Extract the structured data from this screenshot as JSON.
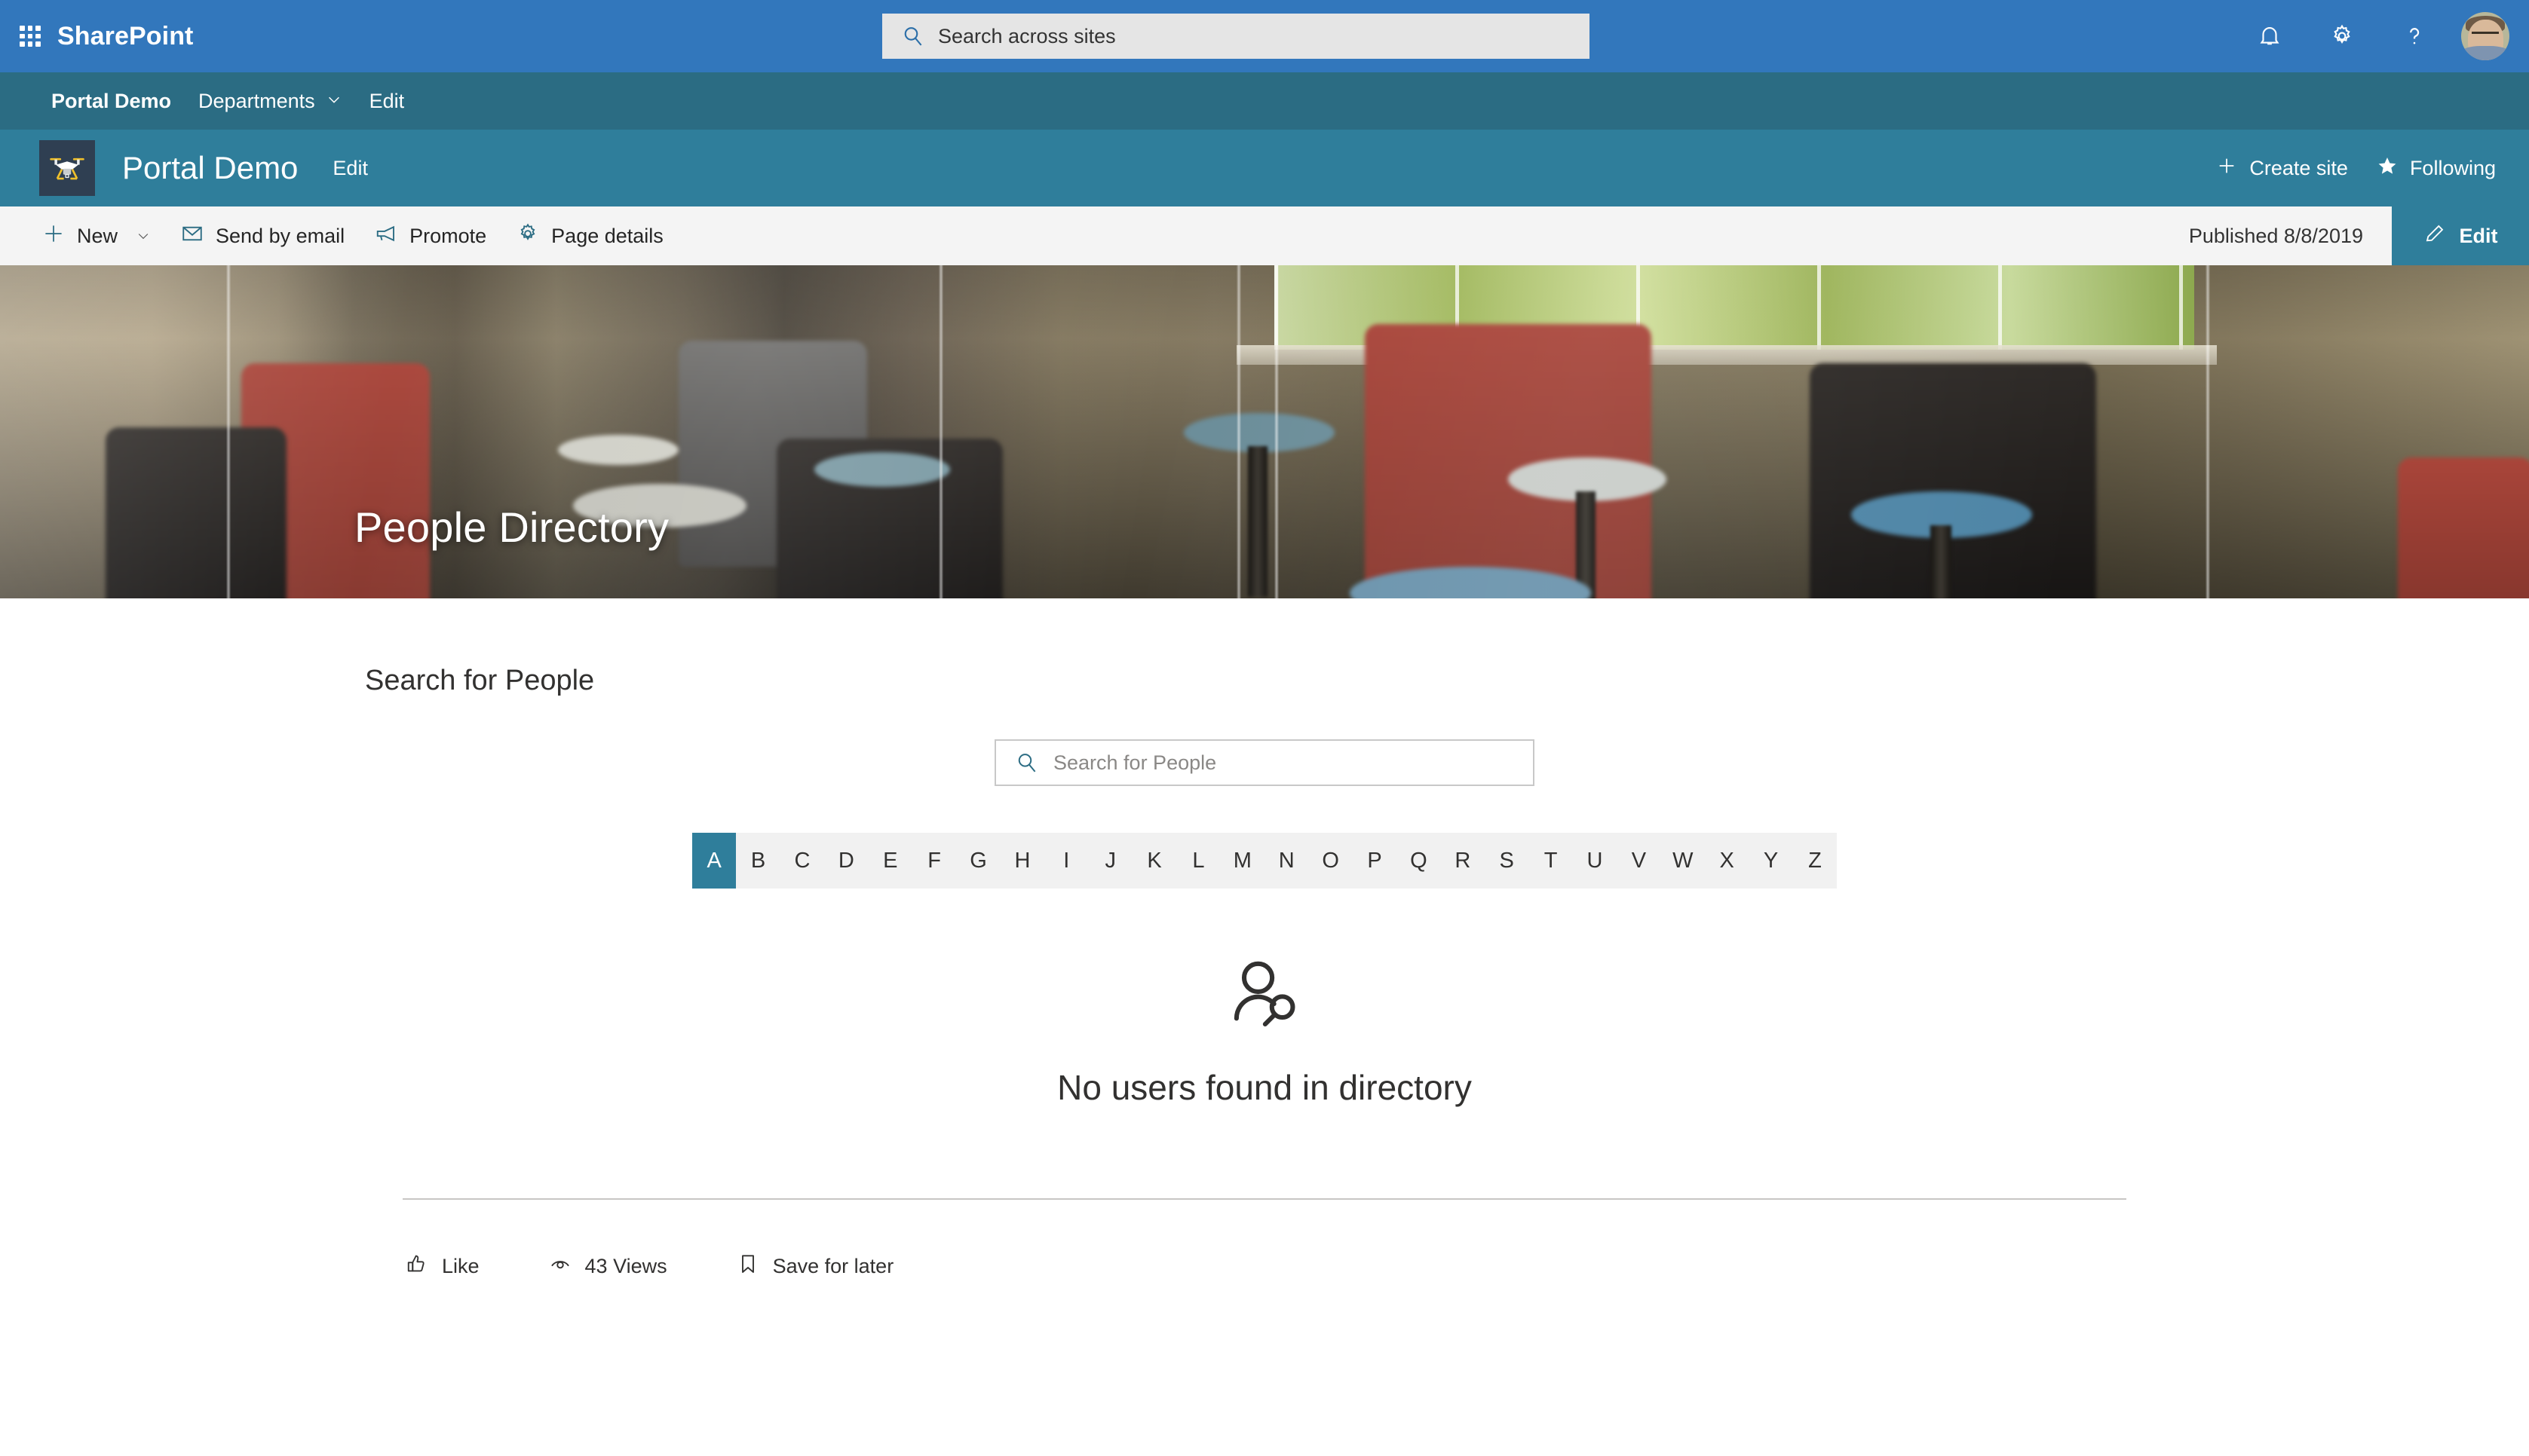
{
  "suite_bar": {
    "waffle_icon": "app-launcher-icon",
    "brand": "SharePoint",
    "search": {
      "icon": "search-icon",
      "placeholder": "Search across sites",
      "value": ""
    },
    "icons": [
      {
        "name": "notifications-icon",
        "glyph": "bell"
      },
      {
        "name": "settings-icon",
        "glyph": "gear"
      },
      {
        "name": "help-icon",
        "glyph": "question"
      }
    ],
    "avatar_label": "account-avatar",
    "colors": {
      "background": "#3277bc",
      "search_background": "#e5e5e5"
    }
  },
  "hub_nav": {
    "background": "#2b6c83",
    "items": [
      {
        "label": "Portal Demo",
        "bold": true,
        "has_chevron": false
      },
      {
        "label": "Departments",
        "bold": false,
        "has_chevron": true
      },
      {
        "label": "Edit",
        "bold": false,
        "has_chevron": false
      }
    ]
  },
  "site_header": {
    "background": "#2f7e9b",
    "logo_icon": "drone-logo-icon",
    "title": "Portal Demo",
    "edit_label": "Edit",
    "actions": [
      {
        "label": "Create site",
        "icon": "plus-icon"
      },
      {
        "label": "Following",
        "icon": "star-icon"
      }
    ]
  },
  "command_bar": {
    "background": "#f4f4f4",
    "items": [
      {
        "label": "New",
        "icon": "plus-icon",
        "has_chevron": true
      },
      {
        "label": "Send by email",
        "icon": "mail-icon",
        "has_chevron": false
      },
      {
        "label": "Promote",
        "icon": "megaphone-icon",
        "has_chevron": false
      },
      {
        "label": "Page details",
        "icon": "gear-icon",
        "has_chevron": false
      }
    ],
    "published_status": "Published 8/8/2019",
    "edit_button": {
      "label": "Edit",
      "icon": "pencil-icon",
      "color": "#2f7e9b"
    }
  },
  "hero": {
    "title": "People Directory",
    "image_alt": "office-lounge-chairs-photo"
  },
  "main": {
    "webpart_title": "Search for People",
    "search": {
      "icon": "search-icon",
      "placeholder": "Search for People",
      "value": ""
    },
    "alphabet": {
      "letters": [
        "A",
        "B",
        "C",
        "D",
        "E",
        "F",
        "G",
        "H",
        "I",
        "J",
        "K",
        "L",
        "M",
        "N",
        "O",
        "P",
        "Q",
        "R",
        "S",
        "T",
        "U",
        "V",
        "W",
        "X",
        "Y",
        "Z"
      ],
      "active": "A",
      "active_color": "#2f7e9b",
      "background": "#f1f1f1"
    },
    "empty_state": {
      "icon": "person-search-icon",
      "message": "No users found in directory"
    }
  },
  "footer": {
    "actions": [
      {
        "label": "Like",
        "icon": "thumbs-up-icon"
      },
      {
        "label": "43 Views",
        "icon": "eye-icon"
      },
      {
        "label": "Save for later",
        "icon": "bookmark-icon"
      }
    ]
  }
}
